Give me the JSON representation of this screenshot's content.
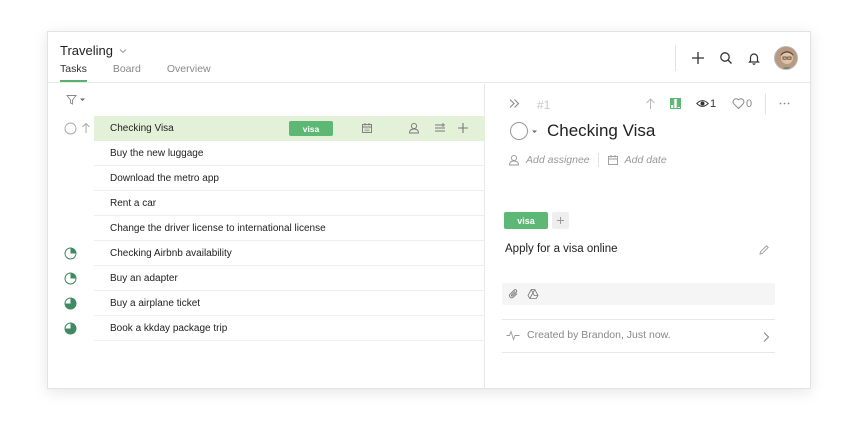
{
  "header": {
    "project_title": "Traveling",
    "tabs": [
      {
        "label": "Tasks",
        "active": true
      },
      {
        "label": "Board",
        "active": false
      },
      {
        "label": "Overview",
        "active": false
      }
    ],
    "tools": [
      "plus-icon",
      "search-icon",
      "bell-icon",
      "avatar"
    ]
  },
  "colors": {
    "accent_green": "#5cb874",
    "selected_row": "#e4f1d9",
    "tab_underline": "#5aaf6c"
  },
  "tasks": [
    {
      "title": "Checking Visa",
      "status": "empty-circle",
      "selected": true,
      "tag": "visa"
    },
    {
      "title": "Buy the new luggage",
      "status": "none"
    },
    {
      "title": "Download the metro app",
      "status": "none"
    },
    {
      "title": "Rent a car",
      "status": "none"
    },
    {
      "title": "Change the driver license to international license",
      "status": "none"
    },
    {
      "title": "Checking Airbnb availability",
      "status": "quarter"
    },
    {
      "title": "Buy an adapter",
      "status": "quarter"
    },
    {
      "title": "Buy a airplane ticket",
      "status": "three-quarter"
    },
    {
      "title": "Book a kkday package trip",
      "status": "three-quarter"
    }
  ],
  "detail": {
    "number": "#1",
    "watchers": "1",
    "likes": "0",
    "title": "Checking Visa",
    "add_assignee": "Add assignee",
    "add_date": "Add date",
    "tag": "visa",
    "description": "Apply for a visa online",
    "activity": "Created by Brandon, Just now."
  }
}
